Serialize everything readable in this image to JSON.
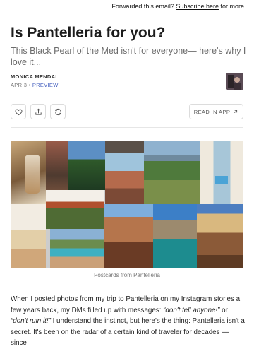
{
  "forwarded": {
    "text": "Forwarded this email?",
    "link": "Subscribe here",
    "suffix": "for more"
  },
  "post": {
    "title": "Is Pantelleria for you?",
    "subtitle": "This Black Pearl of the Med isn't for everyone— here's why I love it...",
    "author": "MONICA MENDAL",
    "date": "APR 3",
    "separator": "•",
    "preview": "PREVIEW"
  },
  "actions": {
    "read_in_app": "READ IN APP",
    "like_icon": "heart-icon",
    "share_icon": "share-icon",
    "restack_icon": "restack-icon",
    "arrow_icon": "arrow-up-right-icon"
  },
  "image": {
    "caption": "Postcards from Pantelleria"
  },
  "body": {
    "p1_a": "When I posted photos from my trip to Pantelleria on my Instagram stories a few years back, my DMs filled up with messages: ",
    "q1": "“don't tell anyone!”",
    "p1_b": " or ",
    "q2": "“don't ruin it!”",
    "p1_c": " I understand the instinct, but here's the thing: Pantelleria isn't a secret. It's been on the radar of a certain kind of traveler for decades — since"
  }
}
